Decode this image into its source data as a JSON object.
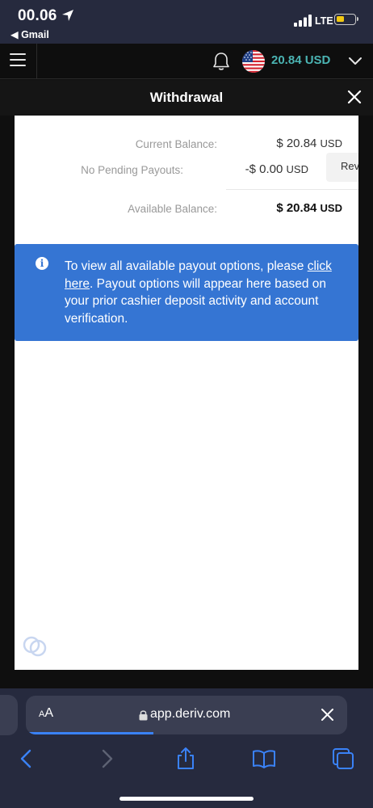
{
  "status_bar": {
    "time": "00.06",
    "back_app": "◀ Gmail",
    "network": "LTE"
  },
  "app_header": {
    "balance_display": "20.84 USD",
    "currency_flag": "us-flag",
    "icons": [
      "menu-icon",
      "bell-icon",
      "chevron-down-icon"
    ]
  },
  "withdrawal": {
    "title": "Withdrawal",
    "current_balance_label": "Current Balance:",
    "current_balance_value": "$ 20.84",
    "current_balance_currency": "USD",
    "pending_label": "No Pending Payouts:",
    "pending_value": "-$ 0.00",
    "pending_currency": "USD",
    "review_button": "Rev",
    "available_balance_label": "Available Balance:",
    "available_balance_value": "$ 20.84",
    "available_balance_currency": "USD",
    "info_text_before": "To view all available payout options, please ",
    "info_link": "click here",
    "info_text_after": ". Payout options will appear here based on your prior cashier deposit activity and account verification."
  },
  "browser": {
    "text_size_small": "A",
    "text_size_large": "A",
    "url": "app.deriv.com",
    "colors": {
      "accent": "#3a82f7",
      "bar": "#262a3e"
    }
  }
}
